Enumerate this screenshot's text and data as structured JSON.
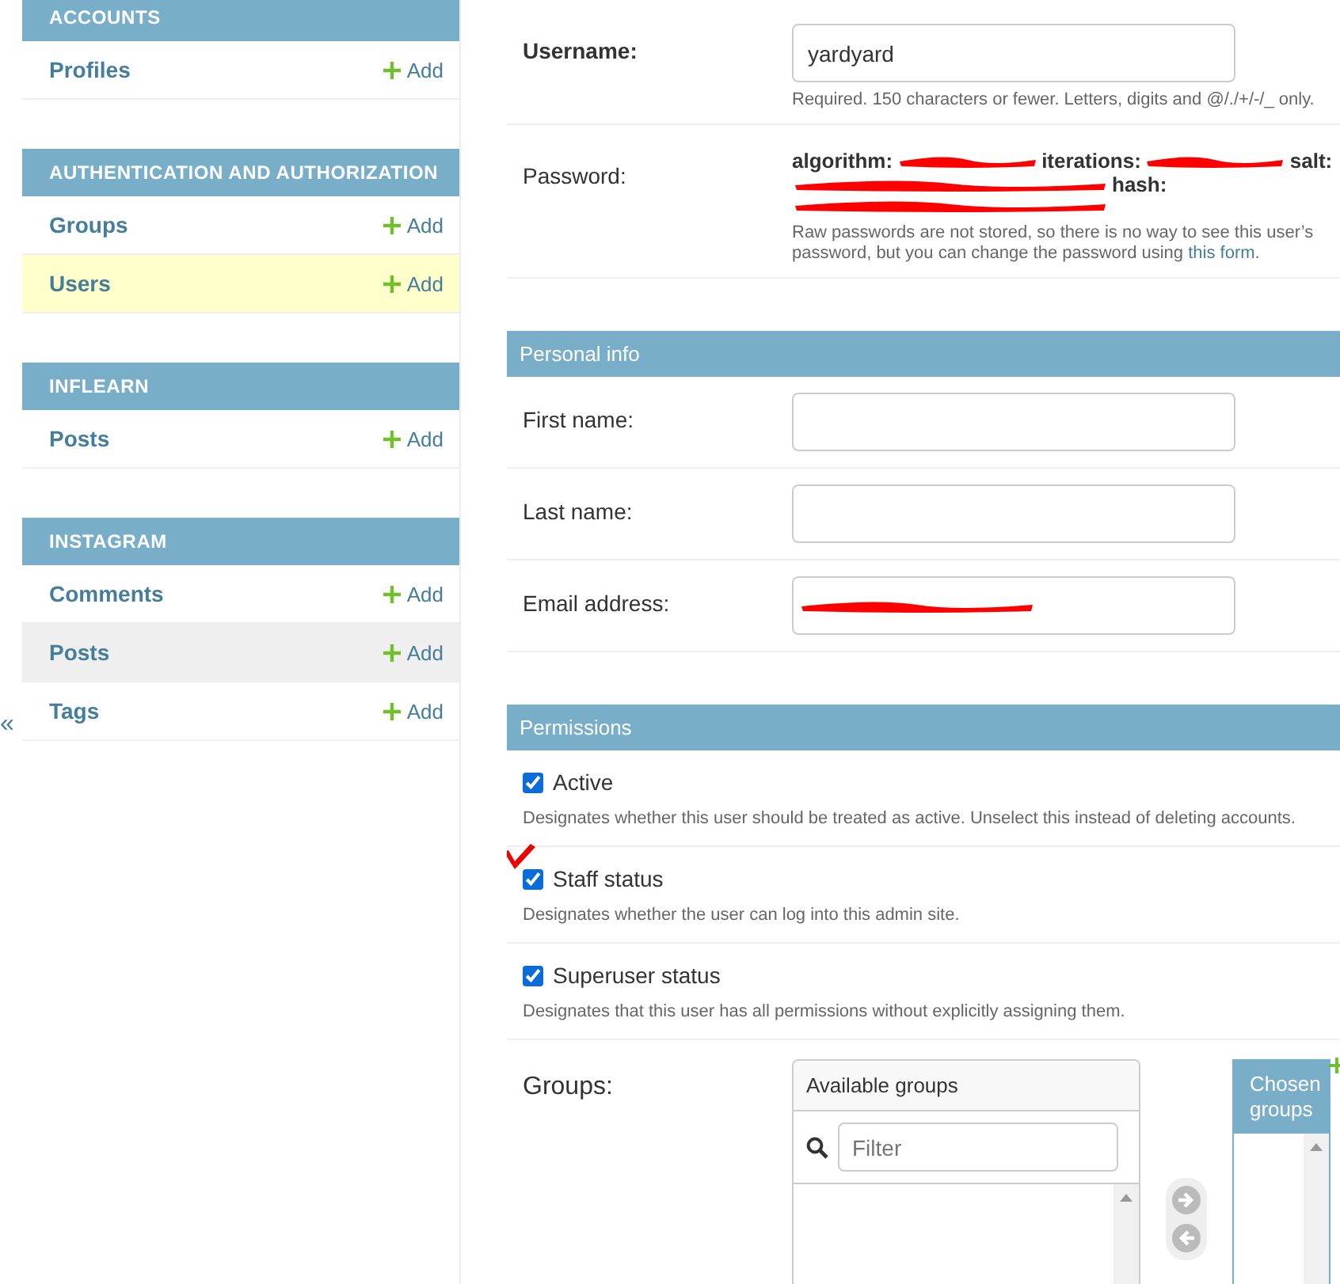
{
  "sidebar": {
    "modules": [
      {
        "title": "ACCOUNTS",
        "models": [
          {
            "name": "Profiles",
            "action": "Add",
            "selected": false,
            "hovered": false
          }
        ]
      },
      {
        "title": "AUTHENTICATION AND AUTHORIZATION",
        "models": [
          {
            "name": "Groups",
            "action": "Add",
            "selected": false,
            "hovered": false
          },
          {
            "name": "Users",
            "action": "Add",
            "selected": true,
            "hovered": false
          }
        ]
      },
      {
        "title": "INFLEARN",
        "models": [
          {
            "name": "Posts",
            "action": "Add",
            "selected": false,
            "hovered": false
          }
        ]
      },
      {
        "title": "INSTAGRAM",
        "models": [
          {
            "name": "Comments",
            "action": "Add",
            "selected": false,
            "hovered": false
          },
          {
            "name": "Posts",
            "action": "Add",
            "selected": false,
            "hovered": true
          },
          {
            "name": "Tags",
            "action": "Add",
            "selected": false,
            "hovered": false
          }
        ]
      }
    ],
    "collapse_toggle": "«"
  },
  "form": {
    "top_fields": [
      {
        "kind": "text",
        "label": "Username:",
        "required": true,
        "value": "yardyard",
        "help": "Required. 150 characters or fewer. Letters, digits and @/./+/-/_ only."
      },
      {
        "kind": "password",
        "label": "Password:",
        "required": false,
        "lines": [
          [
            {
              "kind": "key",
              "text": "algorithm:"
            },
            {
              "kind": "redacted"
            },
            {
              "kind": "key",
              "text": "iterations:"
            },
            {
              "kind": "redacted"
            },
            {
              "kind": "key",
              "text": "salt:"
            }
          ],
          [
            {
              "kind": "redacted"
            },
            {
              "kind": "key",
              "text": "hash:"
            }
          ],
          [
            {
              "kind": "redacted"
            }
          ]
        ],
        "help": "Raw passwords are not stored, so there is no way to see this user’s password, but you can change the password using",
        "link": "this form",
        "help_end": "."
      }
    ],
    "sections": [
      {
        "title": "Personal info",
        "fields": [
          {
            "label": "First name:",
            "redacted": false
          },
          {
            "label": "Last name:",
            "redacted": false
          },
          {
            "label": "Email address:",
            "redacted": true
          }
        ]
      },
      {
        "title": "Permissions",
        "checkboxes": [
          {
            "label": "Active",
            "checked": true,
            "annotated": false,
            "help": "Designates whether this user should be treated as active. Unselect this instead of deleting accounts."
          },
          {
            "label": "Staff status",
            "checked": true,
            "annotated": true,
            "help": "Designates whether the user can log into this admin site."
          },
          {
            "label": "Superuser status",
            "checked": true,
            "annotated": false,
            "help": "Designates that this user has all permissions without explicitly assigning them."
          }
        ],
        "selector": {
          "label": "Groups:",
          "available_title": "Available groups",
          "filter_placeholder": "Filter",
          "chosen_title": "Chosen groups"
        }
      }
    ]
  }
}
